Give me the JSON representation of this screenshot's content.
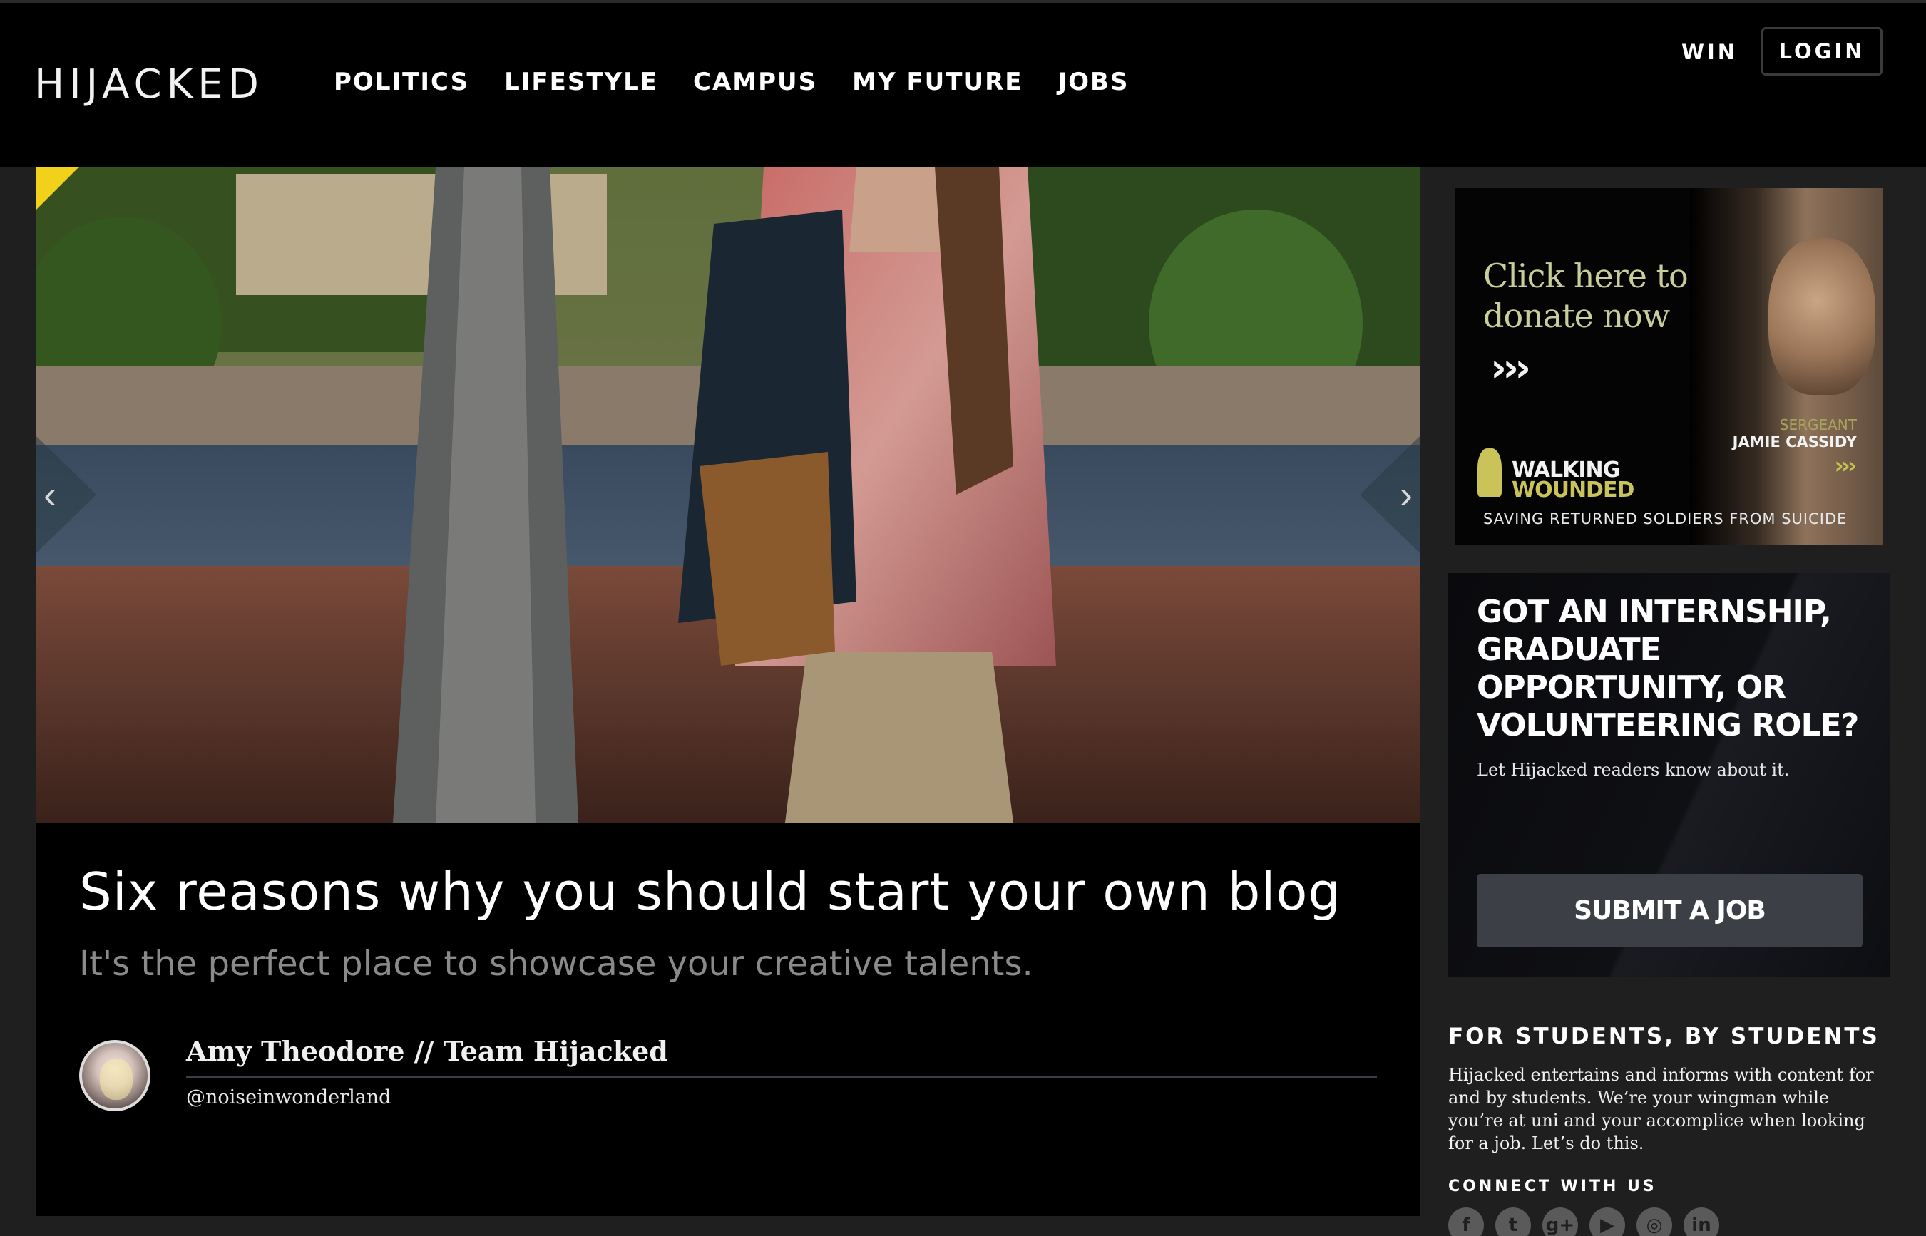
{
  "site": {
    "logo": "HIJACKED"
  },
  "nav": {
    "items": [
      "POLITICS",
      "LIFESTYLE",
      "CAMPUS",
      "MY FUTURE",
      "JOBS"
    ],
    "win": "WIN",
    "login": "LOGIN"
  },
  "article": {
    "headline": "Six reasons why you should start your own blog",
    "subhead": "It's the perfect place to showcase your creative talents.",
    "author": "Amy Theodore // Team Hijacked",
    "handle": "@noiseinwonderland"
  },
  "ad": {
    "cta": "Click here to donate now",
    "rank": "SERGEANT",
    "name": "JAMIE CASSIDY",
    "brand_line1": "WALKING",
    "brand_line2": "WOUNDED",
    "tagline": "SAVING RETURNED SOLDIERS FROM SUICIDE",
    "accent": "#c9c35a"
  },
  "job_box": {
    "title": "GOT AN INTERNSHIP, GRADUATE OPPORTUNITY, OR VOLUNTEERING ROLE?",
    "subtitle": "Let Hijacked readers know about it.",
    "button": "SUBMIT A JOB"
  },
  "about": {
    "title": "FOR STUDENTS, BY STUDENTS",
    "text": "Hijacked entertains and informs with content for and by students. We’re your wingman while you’re at uni and your accomplice when looking for a job. Let’s do this.",
    "connect": "CONNECT WITH US",
    "social_icons": [
      "facebook-icon",
      "twitter-icon",
      "googleplus-icon",
      "youtube-icon",
      "instagram-icon",
      "linkedin-icon"
    ]
  },
  "colors": {
    "corner_flag": "#f2d11b",
    "background": "#1f1f1f"
  }
}
